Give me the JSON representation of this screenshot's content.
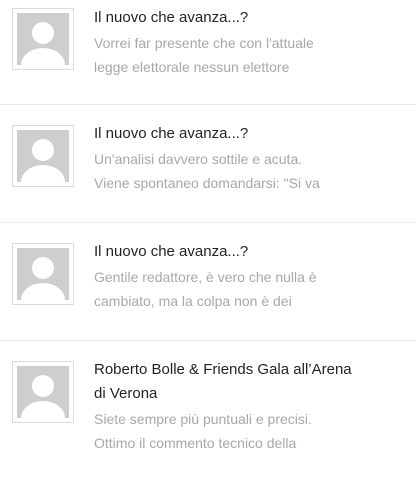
{
  "comments": [
    {
      "title": "Il nuovo che avanza...?",
      "excerpt_line1": "Vorrei far presente che con l'attuale",
      "excerpt_line2": "legge elettorale nessun elettore"
    },
    {
      "title": "Il nuovo che avanza...?",
      "excerpt_line1": "Un'analisi davvero sottile e acuta.",
      "excerpt_line2": "Viene spontaneo domandarsi: \"Si va"
    },
    {
      "title": "Il nuovo che avanza...?",
      "excerpt_line1": "Gentile redattore, è vero che nulla è",
      "excerpt_line2": "cambiato, ma la colpa non è dei"
    },
    {
      "title_line1": "Roberto Bolle & Friends Gala all’Arena",
      "title_line2": "di Verona",
      "excerpt_line1": "Siete sempre più puntuali e precisi.",
      "excerpt_line2": "Ottimo il commento tecnico della"
    }
  ],
  "colors": {
    "title": "#1d2124",
    "excerpt": "#a8a8a8",
    "avatar_bg": "#cecece",
    "avatar_silhouette": "#ffffff",
    "divider": "#ebebeb"
  },
  "icons": {
    "avatar": "default-user-avatar-icon"
  }
}
